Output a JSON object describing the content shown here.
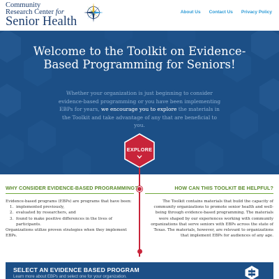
{
  "logo": {
    "line1": "Community",
    "line2_prefix": "Research Center ",
    "line2_italic": "for",
    "line3": "Senior Health"
  },
  "nav": {
    "items": [
      {
        "label": "About Us"
      },
      {
        "label": "Contact Us"
      },
      {
        "label": "Privacy Policy"
      }
    ]
  },
  "hero": {
    "title": "Welcome to the Toolkit on Evidence-Based Programming for Seniors!",
    "intro_part1": "Whether your organization is just beginning to consider evidence-based programming or you have been implementing EBPs for years, ",
    "intro_highlight": "we encourage you to explore",
    "intro_part2": " the materials in the Toolkit and take advantage of any that are beneficial to you.",
    "explore_label": "EXPLORE"
  },
  "why": {
    "heading": "WHY CONSIDER EVIDENCE-BASED PROGRAMMING?",
    "intro": "Evidence-based programs (EBPs) are programs that have been:",
    "list": [
      "implemented previously,",
      "evaluated by researchers, and",
      "found to make positive differences in the lives of participants."
    ],
    "outro": "Organizations utilize proven strategies when they implement EBPs."
  },
  "how": {
    "heading": "HOW CAN THIS TOOLKIT BE HELPFUL?",
    "body": "The Toolkit contains materials that build the capacity of community organizations to promote senior health and well-being through evidence-based programming. The materials were shaped by our experiences working with community organizations that serve seniors with EBPs across the state of Texas. The materials, however, are relevant to organizations that implement EBPs for audiences of any age."
  },
  "select": {
    "title": "SELECT AN EVIDENCE BASED PROGRAM",
    "subtitle": "Learn more about EBPs and select one for your organization."
  },
  "colors": {
    "brand_navy": "#1c4f86",
    "accent_red": "#c8243a",
    "accent_green": "#5a8b2b",
    "link_blue": "#2e9bd6"
  },
  "icons": {
    "logo_mark": "compass-star-icon",
    "explore_arrow": "chevron-down-icon",
    "select_badge": "signpost-icon"
  }
}
